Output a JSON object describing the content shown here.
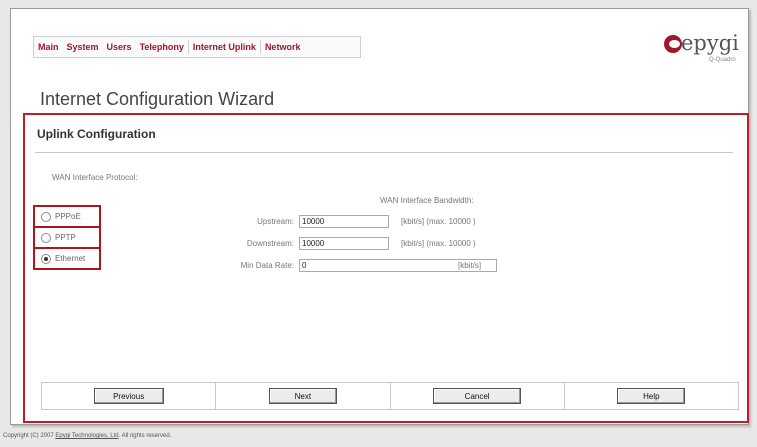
{
  "menu": [
    "Main",
    "System",
    "Users",
    "Telephony",
    "Internet Uplink",
    "Network"
  ],
  "logo": {
    "brand": "epygi",
    "model": "Q-Quadro"
  },
  "page_title": "Internet Configuration Wizard",
  "panel": {
    "title": "Uplink Configuration",
    "wan_protocol_label": "WAN Interface Protocol:",
    "protocols": [
      {
        "label": "PPPoE",
        "selected": false
      },
      {
        "label": "PPTP",
        "selected": false
      },
      {
        "label": "Ethernet",
        "selected": true
      }
    ],
    "bandwidth_header": "WAN Interface Bandwidth:",
    "upstream": {
      "label": "Upstream:",
      "value": "10000",
      "hint": "[kbit/s] (max. 10000 )"
    },
    "downstream": {
      "label": "Downstream:",
      "value": "10000",
      "hint": "[kbit/s] (max. 10000 )"
    },
    "min_rate": {
      "label": "Min Data Rate:",
      "value": "0",
      "hint": "[kbit/s]"
    }
  },
  "buttons": {
    "previous": "Previous",
    "next": "Next",
    "cancel": "Cancel",
    "help": "Help"
  },
  "footer": {
    "prefix": "Copyright (C) 2007 ",
    "company": "Epygi Technologies, Ltd",
    "suffix": ". All rights reserved."
  },
  "colors": {
    "accent": "#a1162a",
    "panel_border": "#c21a28"
  }
}
